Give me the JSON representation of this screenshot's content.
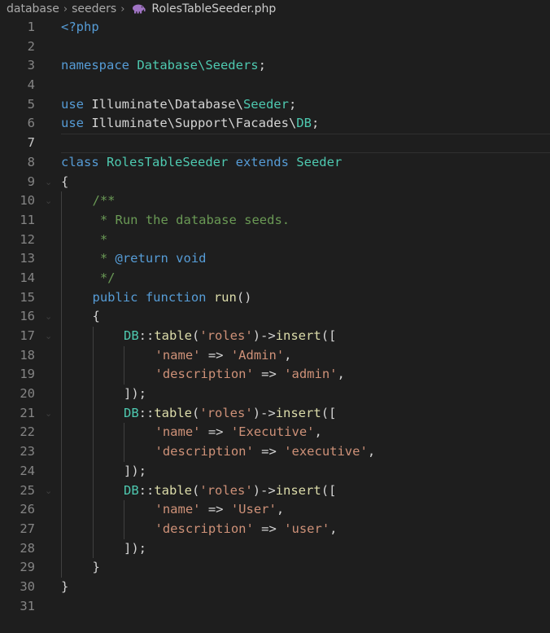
{
  "breadcrumb": {
    "folder1": "database",
    "folder2": "seeders",
    "file": "RolesTableSeeder.php"
  },
  "editor": {
    "current_line": 7,
    "language": "php",
    "file_icon": "php-elephant-icon",
    "lines": [
      {
        "n": "1",
        "tokens": [
          {
            "t": "<?php",
            "c": "kw"
          }
        ]
      },
      {
        "n": "2",
        "tokens": []
      },
      {
        "n": "3",
        "tokens": [
          {
            "t": "namespace ",
            "c": "kw"
          },
          {
            "t": "Database\\Seeders",
            "c": "cls"
          },
          {
            "t": ";",
            "c": "plain"
          }
        ]
      },
      {
        "n": "4",
        "tokens": []
      },
      {
        "n": "5",
        "tokens": [
          {
            "t": "use ",
            "c": "kw"
          },
          {
            "t": "Illuminate\\Database\\",
            "c": "plain"
          },
          {
            "t": "Seeder",
            "c": "cls"
          },
          {
            "t": ";",
            "c": "plain"
          }
        ]
      },
      {
        "n": "6",
        "tokens": [
          {
            "t": "use ",
            "c": "kw"
          },
          {
            "t": "Illuminate\\Support\\Facades\\",
            "c": "plain"
          },
          {
            "t": "DB",
            "c": "cls"
          },
          {
            "t": ";",
            "c": "plain"
          }
        ]
      },
      {
        "n": "7",
        "tokens": []
      },
      {
        "n": "8",
        "tokens": [
          {
            "t": "class ",
            "c": "kw"
          },
          {
            "t": "RolesTableSeeder ",
            "c": "cls"
          },
          {
            "t": "extends ",
            "c": "kw"
          },
          {
            "t": "Seeder",
            "c": "cls"
          }
        ]
      },
      {
        "n": "9",
        "fold": true,
        "tokens": [
          {
            "t": "{",
            "c": "plain"
          }
        ]
      },
      {
        "n": "10",
        "fold": true,
        "indent": 1,
        "tokens": [
          {
            "t": "/**",
            "c": "cmt"
          }
        ]
      },
      {
        "n": "11",
        "indent": 1,
        "tokens": [
          {
            "t": " * Run the database seeds.",
            "c": "cmt"
          }
        ]
      },
      {
        "n": "12",
        "indent": 1,
        "tokens": [
          {
            "t": " *",
            "c": "cmt"
          }
        ]
      },
      {
        "n": "13",
        "indent": 1,
        "tokens": [
          {
            "t": " * ",
            "c": "cmt"
          },
          {
            "t": "@return",
            "c": "doc"
          },
          {
            "t": " ",
            "c": "cmt"
          },
          {
            "t": "void",
            "c": "doc"
          }
        ]
      },
      {
        "n": "14",
        "indent": 1,
        "tokens": [
          {
            "t": " */",
            "c": "cmt"
          }
        ]
      },
      {
        "n": "15",
        "indent": 1,
        "tokens": [
          {
            "t": "public ",
            "c": "kw"
          },
          {
            "t": "function ",
            "c": "kw"
          },
          {
            "t": "run",
            "c": "fn"
          },
          {
            "t": "()",
            "c": "plain"
          }
        ]
      },
      {
        "n": "16",
        "fold": true,
        "indent": 1,
        "tokens": [
          {
            "t": "{",
            "c": "plain"
          }
        ]
      },
      {
        "n": "17",
        "fold": true,
        "indent": 2,
        "tokens": [
          {
            "t": "DB",
            "c": "cls"
          },
          {
            "t": "::",
            "c": "plain"
          },
          {
            "t": "table",
            "c": "fn"
          },
          {
            "t": "(",
            "c": "plain"
          },
          {
            "t": "'roles'",
            "c": "str"
          },
          {
            "t": ")->",
            "c": "plain"
          },
          {
            "t": "insert",
            "c": "fn"
          },
          {
            "t": "([",
            "c": "plain"
          }
        ]
      },
      {
        "n": "18",
        "indent": 3,
        "tokens": [
          {
            "t": "'name'",
            "c": "str"
          },
          {
            "t": " => ",
            "c": "plain"
          },
          {
            "t": "'Admin'",
            "c": "str"
          },
          {
            "t": ",",
            "c": "plain"
          }
        ]
      },
      {
        "n": "19",
        "indent": 3,
        "tokens": [
          {
            "t": "'description'",
            "c": "str"
          },
          {
            "t": " => ",
            "c": "plain"
          },
          {
            "t": "'admin'",
            "c": "str"
          },
          {
            "t": ",",
            "c": "plain"
          }
        ]
      },
      {
        "n": "20",
        "indent": 2,
        "tokens": [
          {
            "t": "]);",
            "c": "plain"
          }
        ]
      },
      {
        "n": "21",
        "fold": true,
        "indent": 2,
        "tokens": [
          {
            "t": "DB",
            "c": "cls"
          },
          {
            "t": "::",
            "c": "plain"
          },
          {
            "t": "table",
            "c": "fn"
          },
          {
            "t": "(",
            "c": "plain"
          },
          {
            "t": "'roles'",
            "c": "str"
          },
          {
            "t": ")->",
            "c": "plain"
          },
          {
            "t": "insert",
            "c": "fn"
          },
          {
            "t": "([",
            "c": "plain"
          }
        ]
      },
      {
        "n": "22",
        "indent": 3,
        "tokens": [
          {
            "t": "'name'",
            "c": "str"
          },
          {
            "t": " => ",
            "c": "plain"
          },
          {
            "t": "'Executive'",
            "c": "str"
          },
          {
            "t": ",",
            "c": "plain"
          }
        ]
      },
      {
        "n": "23",
        "indent": 3,
        "tokens": [
          {
            "t": "'description'",
            "c": "str"
          },
          {
            "t": " => ",
            "c": "plain"
          },
          {
            "t": "'executive'",
            "c": "str"
          },
          {
            "t": ",",
            "c": "plain"
          }
        ]
      },
      {
        "n": "24",
        "indent": 2,
        "tokens": [
          {
            "t": "]);",
            "c": "plain"
          }
        ]
      },
      {
        "n": "25",
        "fold": true,
        "indent": 2,
        "tokens": [
          {
            "t": "DB",
            "c": "cls"
          },
          {
            "t": "::",
            "c": "plain"
          },
          {
            "t": "table",
            "c": "fn"
          },
          {
            "t": "(",
            "c": "plain"
          },
          {
            "t": "'roles'",
            "c": "str"
          },
          {
            "t": ")->",
            "c": "plain"
          },
          {
            "t": "insert",
            "c": "fn"
          },
          {
            "t": "([",
            "c": "plain"
          }
        ]
      },
      {
        "n": "26",
        "indent": 3,
        "tokens": [
          {
            "t": "'name'",
            "c": "str"
          },
          {
            "t": " => ",
            "c": "plain"
          },
          {
            "t": "'User'",
            "c": "str"
          },
          {
            "t": ",",
            "c": "plain"
          }
        ]
      },
      {
        "n": "27",
        "indent": 3,
        "tokens": [
          {
            "t": "'description'",
            "c": "str"
          },
          {
            "t": " => ",
            "c": "plain"
          },
          {
            "t": "'user'",
            "c": "str"
          },
          {
            "t": ",",
            "c": "plain"
          }
        ]
      },
      {
        "n": "28",
        "indent": 2,
        "tokens": [
          {
            "t": "]);",
            "c": "plain"
          }
        ]
      },
      {
        "n": "29",
        "indent": 1,
        "tokens": [
          {
            "t": "}",
            "c": "plain"
          }
        ]
      },
      {
        "n": "30",
        "tokens": [
          {
            "t": "}",
            "c": "plain"
          }
        ]
      },
      {
        "n": "31",
        "tokens": []
      }
    ]
  },
  "colors": {
    "background": "#1e1e1e",
    "keyword": "#569cd6",
    "class": "#4ec9b0",
    "function": "#dcdcaa",
    "string": "#ce9178",
    "comment": "#6a9955",
    "text": "#d4d4d4",
    "line_number": "#858585"
  }
}
